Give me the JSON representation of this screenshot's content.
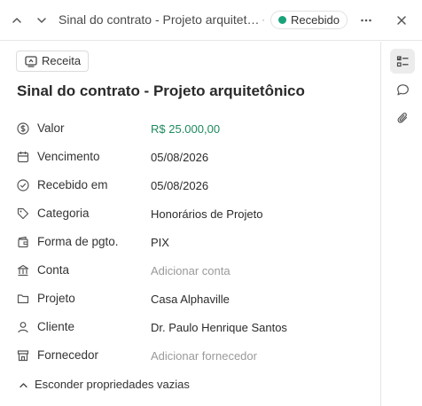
{
  "header": {
    "title": "Sinal do contrato - Projeto arquitetônico",
    "separator": "·",
    "status": "Recebido",
    "status_color": "#1aa37a"
  },
  "type_chip": {
    "label": "Receita"
  },
  "page_title": "Sinal do contrato - Projeto arquitetônico",
  "properties": [
    {
      "label": "Valor",
      "value": "R$ 25.000,00",
      "icon": "dollar-circle-icon"
    },
    {
      "label": "Vencimento",
      "value": "05/08/2026",
      "icon": "calendar-icon"
    },
    {
      "label": "Recebido em",
      "value": "05/08/2026",
      "icon": "check-circle-icon"
    },
    {
      "label": "Categoria",
      "value": "Honorários de Projeto",
      "icon": "tag-icon"
    },
    {
      "label": "Forma de pgto.",
      "value": "PIX",
      "icon": "wallet-icon"
    },
    {
      "label": "Conta",
      "value": "Adicionar conta",
      "icon": "bank-icon"
    },
    {
      "label": "Projeto",
      "value": "Casa Alphaville",
      "icon": "folder-icon"
    },
    {
      "label": "Cliente",
      "value": "Dr. Paulo Henrique Santos",
      "icon": "person-icon"
    },
    {
      "label": "Fornecedor",
      "value": "Adicionar fornecedor",
      "icon": "store-icon"
    }
  ],
  "hide_empty": "Esconder propriedades vazias",
  "colors": {
    "money": "#1f8a5e",
    "placeholder": "#9a9a9a"
  }
}
